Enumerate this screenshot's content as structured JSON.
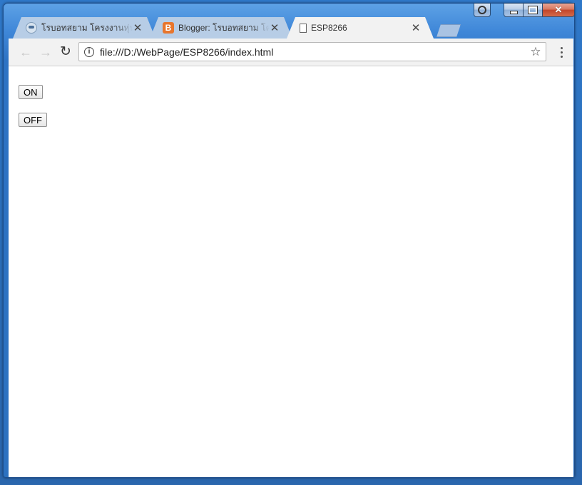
{
  "tabs": [
    {
      "title": "โรบอทสยาม โครงงานหุ่นยนต์",
      "favicon": "robot-favicon-icon",
      "active": false
    },
    {
      "title": "Blogger: โรบอทสยาม โครงงาน",
      "favicon": "blogger-favicon-icon",
      "favicon_letter": "B",
      "active": false
    },
    {
      "title": "ESP8266",
      "favicon": "page-favicon-icon",
      "active": true
    }
  ],
  "tab_close_glyph": "✕",
  "toolbar": {
    "back_glyph": "←",
    "forward_glyph": "→",
    "reload_glyph": "↻",
    "url": "file:///D:/WebPage/ESP8266/index.html",
    "info_glyph": "i",
    "bookmark_glyph": "☆"
  },
  "window_controls": {
    "close_glyph": "✕"
  },
  "page": {
    "on_label": "ON",
    "off_label": "OFF"
  },
  "colors": {
    "frame": "#2c71c0",
    "active_tab": "#f2f2f2",
    "inactive_tab": "#b7cde6",
    "blogger": "#e8762d"
  }
}
